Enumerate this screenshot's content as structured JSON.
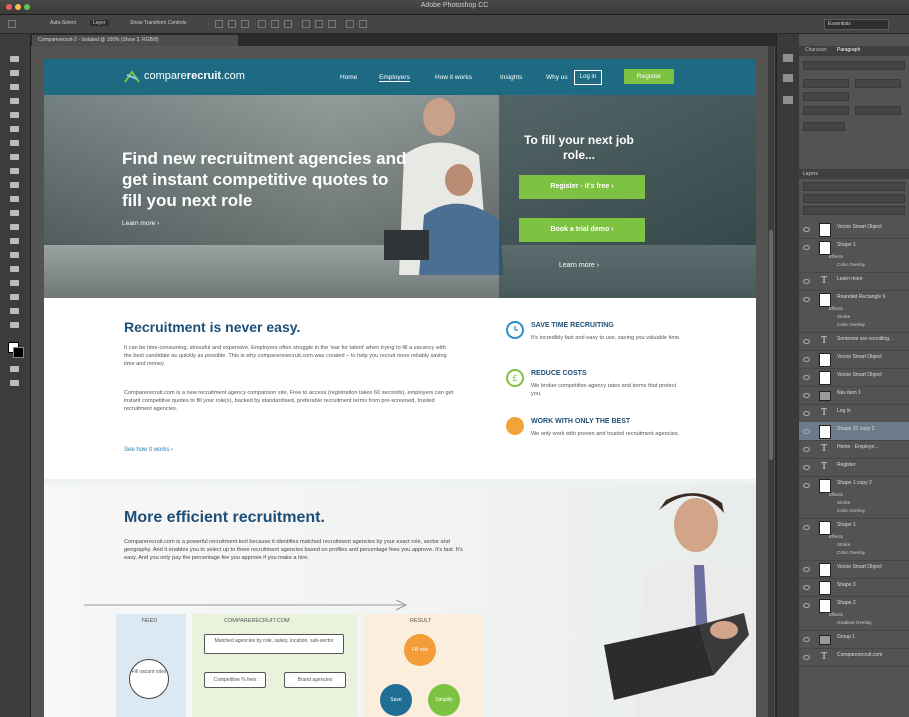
{
  "window": {
    "title": "Adobe Photoshop CC"
  },
  "options_bar": {
    "auto_select": "Auto-Select",
    "auto_select_value": "Layer",
    "transform": "Show Transform Controls",
    "workspace": "Essentials"
  },
  "document_tab": "Comparerecruit-2 - Isolated @ 100% (Show 3, RGB/8)",
  "site": {
    "logo_prefix": "compare",
    "logo_bold": "recruit",
    "logo_suffix": ".com",
    "nav": [
      "Home",
      "Employers",
      "How it works",
      "Insights",
      "Why us"
    ],
    "login": "Log in",
    "register": "Register"
  },
  "hero": {
    "headline": "Find new recruitment agencies and get instant competitive quotes to fill you next role",
    "learn_more": "Learn more ›",
    "panel_title": "To fill your next job role...",
    "btn_register": "Register - it's free  ›",
    "btn_demo": "Book a trial demo  ›",
    "panel_more": "Learn more ›"
  },
  "section1": {
    "title": "Recruitment is never easy.",
    "p1": "It can be time-consuming, stressful and expensive. Employers often struggle in the 'war for talent' when trying to fill a vacancy with the best candidate as quickly as possible. This is why compareresecruit.com was created – to help you recruit more reliably saving time and money.",
    "p2": "Comparerecruit.com is a new recruitment agency comparison site, Free to access (registration takes 60 seconds), employers can get instant competitive quotes to fill your role(s), backed by standardised, preferable recruitment terms from pre-screened, trusted recruitment agencies.",
    "link": "See how it works ›",
    "features": [
      {
        "icon": "clock-icon",
        "title": "SAVE TIME RECRUITING",
        "text": "It's incredibly fast and easy to use, saving you valuable time.",
        "color": "#2a8fc6"
      },
      {
        "icon": "pound-icon",
        "title": "REDUCE COSTS",
        "text": "We broker competitive agency rates and terms that protect you.",
        "color": "#7dc241"
      },
      {
        "icon": "people-icon",
        "title": "WORK WITH ONLY THE BEST",
        "text": "We only work with proven and trusted recruitment agencies.",
        "color": "#f2a33a"
      }
    ]
  },
  "section2": {
    "title": "More efficient recruitment.",
    "text": "Comparerecruit.com is a powerful recruitment tool because it identifies matched recruitment agencies by your exact role, sector and geography. And it enables you to select up to three recruitment agencies based on profiles and percentage fees you approve. It's fast. It's easy. And you only pay the percentage fee you approve if you make a hire."
  },
  "sketch": {
    "need": "NEED",
    "need_circle": "Fill vacant roles",
    "middle": "COMPARERECRUIT.COM",
    "matched": "Matched agencies by role, salary, location, sub-sector",
    "competitive": "Competitive % fees",
    "branding": "Brand agencies",
    "result": "RESULT",
    "fill_role": "Fill role",
    "save": "Save",
    "simplify": "Simplify"
  },
  "panels": {
    "tabs": [
      "Character",
      "Paragraph"
    ],
    "layers_title": "Layers",
    "layers": [
      {
        "name": "Vector Smart Object",
        "kind": "thumb",
        "sub": []
      },
      {
        "name": "Shape 1",
        "kind": "thumb",
        "sub": [
          "Effects",
          "Color Overlay"
        ]
      },
      {
        "name": "Learn more",
        "kind": "text",
        "sub": []
      },
      {
        "name": "Rounded Rectangle 6",
        "kind": "thumb",
        "sub": [
          "Effects",
          "Stroke",
          "Color Overlay"
        ]
      },
      {
        "name": "Someone are recruiting...",
        "kind": "text",
        "sub": []
      },
      {
        "name": "Vector Smart Object",
        "kind": "thumb",
        "sub": []
      },
      {
        "name": "Vector Smart Object",
        "kind": "thumb",
        "sub": []
      },
      {
        "name": "Nav item 1",
        "kind": "folder",
        "sub": []
      },
      {
        "name": "Log in",
        "kind": "text",
        "sub": []
      },
      {
        "name": "Shape 31 copy 2",
        "kind": "thumb",
        "sub": [],
        "selected": true
      },
      {
        "name": "Home  ·  Employe...",
        "kind": "text",
        "sub": []
      },
      {
        "name": "Register",
        "kind": "text",
        "sub": []
      },
      {
        "name": "Shape 1 copy 2",
        "kind": "thumb",
        "sub": [
          "Effects",
          "Stroke",
          "Color Overlay"
        ]
      },
      {
        "name": "Shape 1",
        "kind": "thumb",
        "sub": [
          "Effects",
          "Stroke",
          "Color Overlay"
        ]
      },
      {
        "name": "Vector Smart Object",
        "kind": "thumb",
        "sub": []
      },
      {
        "name": "Shape 3",
        "kind": "thumb",
        "sub": []
      },
      {
        "name": "Shape 2",
        "kind": "thumb",
        "sub": [
          "Effects",
          "Gradient Overlay"
        ]
      },
      {
        "name": "Group 1",
        "kind": "folder",
        "sub": []
      },
      {
        "name": "Comparerecruit.com",
        "kind": "text",
        "sub": []
      }
    ]
  }
}
